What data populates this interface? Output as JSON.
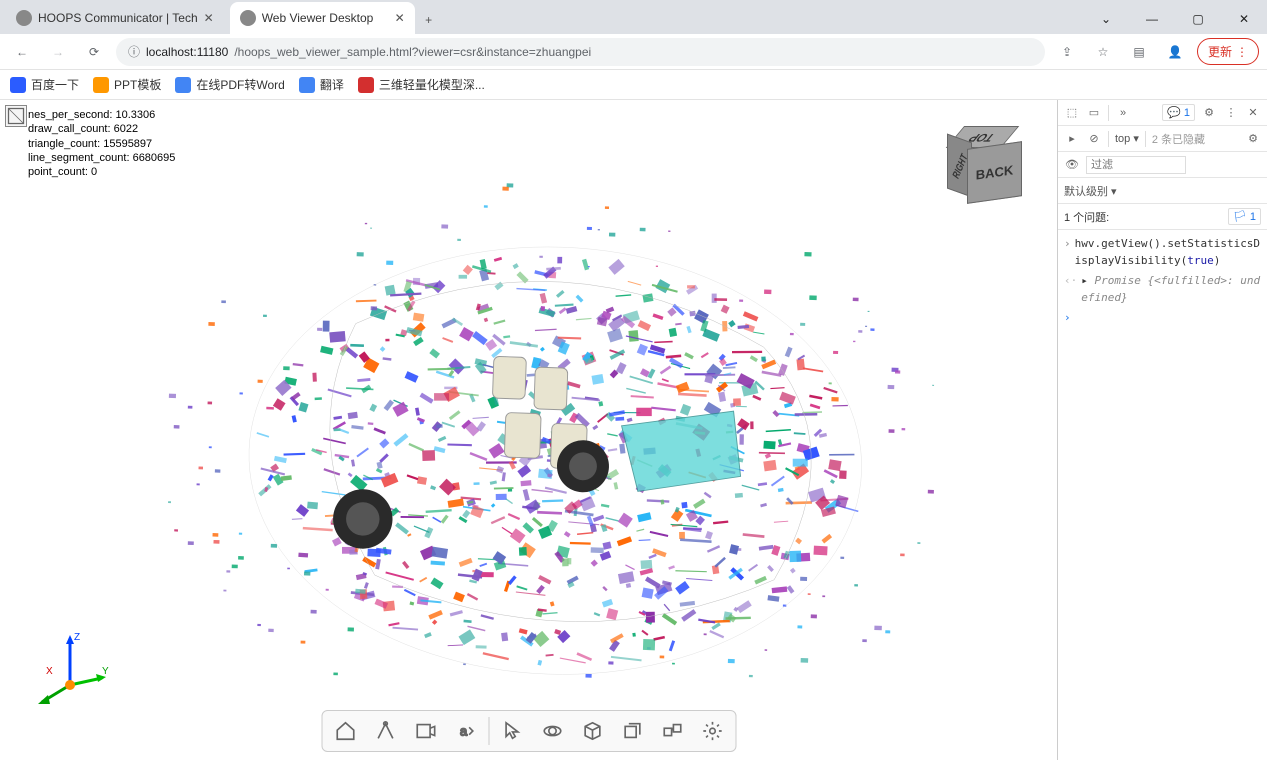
{
  "tabs": [
    {
      "title": "HOOPS Communicator | Tech",
      "active": false
    },
    {
      "title": "Web Viewer Desktop",
      "active": true
    }
  ],
  "url": {
    "host": "localhost",
    "port": ":11180",
    "path": "/hoops_web_viewer_sample.html?viewer=csr&instance=zhuangpei"
  },
  "updateLabel": "更新",
  "bookmarks": [
    {
      "label": "百度一下",
      "color": "#2b5cff"
    },
    {
      "label": "PPT模板",
      "color": "#ff9800"
    },
    {
      "label": "在线PDF转Word",
      "color": "#4285f4"
    },
    {
      "label": "翻译",
      "color": "#4285f4"
    },
    {
      "label": "三维轻量化模型深...",
      "color": "#d32f2f"
    }
  ],
  "stats": {
    "fps": "nes_per_second: 10.3306",
    "drawCalls": "draw_call_count: 6022",
    "triangles": "triangle_count: 15595897",
    "lines": "line_segment_count: 6680695",
    "points": "point_count: 0"
  },
  "navcube": {
    "top": "TOP",
    "side": "RIGHT",
    "front": "BACK"
  },
  "axis": {
    "x": "X",
    "y": "Y",
    "z": "Z"
  },
  "devtools": {
    "tabBadge": "1",
    "hiddenMsg": "2 条已隐藏",
    "filterPlaceholder": "过滤",
    "levelLabel": "默认级别",
    "contextLabel": "top",
    "issueLabel": "1 个问题:",
    "issueCount": "1",
    "console": {
      "input": "hwv.getView().setStatisticsDisplayVisibility(true)",
      "trueKeyword": "true",
      "promisePrefix": "Promise ",
      "promiseBody": "{<fulfilled>: undefined}"
    }
  }
}
